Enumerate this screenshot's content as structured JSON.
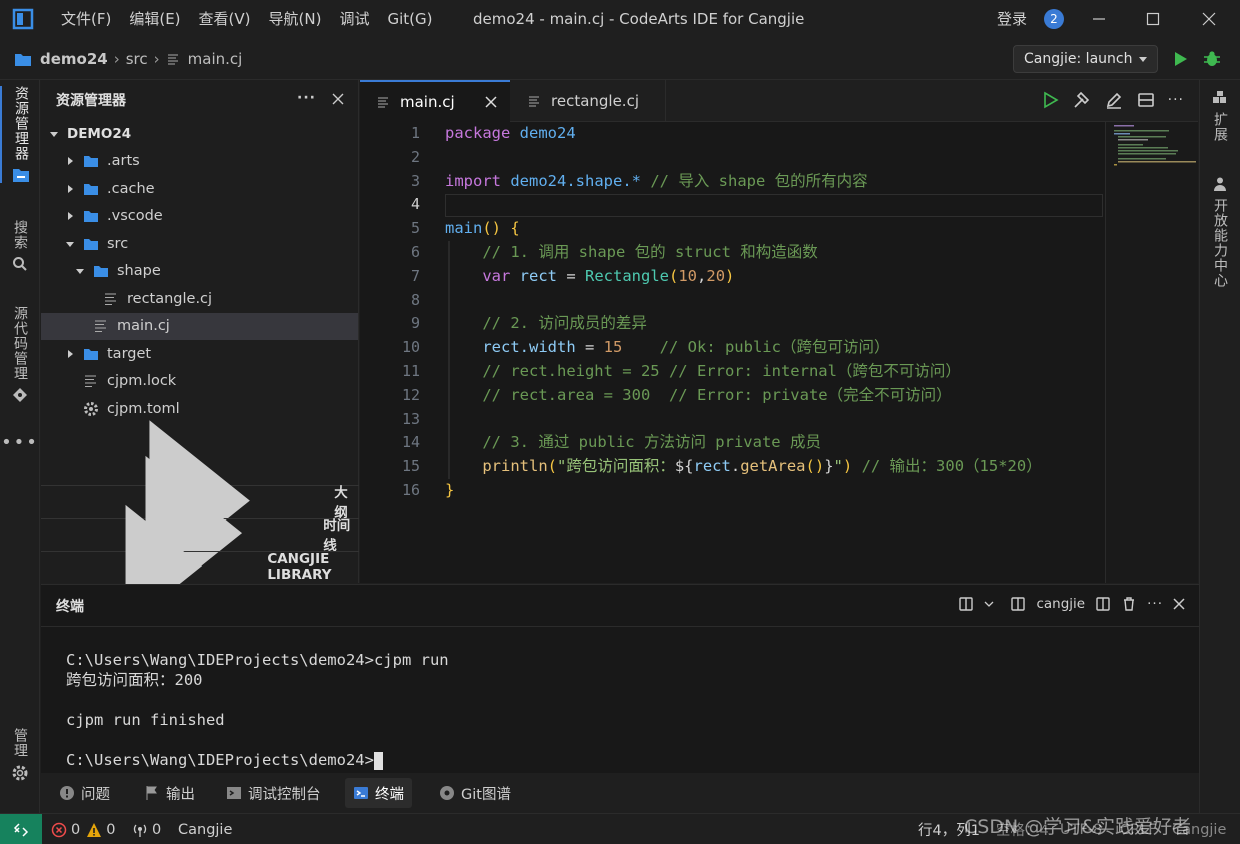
{
  "titlebar": {
    "menus": [
      "文件(F)",
      "编辑(E)",
      "查看(V)",
      "导航(N)",
      "调试",
      "Git(G)"
    ],
    "title": "demo24 - main.cj - CodeArts IDE for Cangjie",
    "login": "登录",
    "badge_count": "2"
  },
  "breadcrumb": {
    "project": "demo24",
    "folder": "src",
    "file": "main.cj"
  },
  "launch": {
    "label": "Cangjie: launch"
  },
  "activity": {
    "explorer": "资源管理器",
    "search": "搜索",
    "scm": "源代码管理",
    "manage": "管理"
  },
  "rightbar": {
    "extensions": "扩展",
    "open_center": "开放能力中心"
  },
  "sidebar": {
    "title": "资源管理器",
    "root": "DEMO24",
    "tree": [
      {
        "label": ".arts",
        "depth": 1,
        "kind": "folder",
        "open": false
      },
      {
        "label": ".cache",
        "depth": 1,
        "kind": "folder",
        "open": false
      },
      {
        "label": ".vscode",
        "depth": 1,
        "kind": "folder",
        "open": false
      },
      {
        "label": "src",
        "depth": 1,
        "kind": "folder",
        "open": true
      },
      {
        "label": "shape",
        "depth": 2,
        "kind": "folder",
        "open": true
      },
      {
        "label": "rectangle.cj",
        "depth": 3,
        "kind": "file"
      },
      {
        "label": "main.cj",
        "depth": 2,
        "kind": "file",
        "selected": true
      },
      {
        "label": "target",
        "depth": 1,
        "kind": "folder",
        "open": false
      },
      {
        "label": "cjpm.lock",
        "depth": 1,
        "kind": "file"
      },
      {
        "label": "cjpm.toml",
        "depth": 1,
        "kind": "gear"
      }
    ],
    "sections": [
      "大纲",
      "时间线",
      "CANGJIE LIBRARY"
    ]
  },
  "tabs": [
    {
      "label": "main.cj",
      "active": true
    },
    {
      "label": "rectangle.cj",
      "active": false
    }
  ],
  "editor": {
    "current_line": 4,
    "lines": [
      "package demo24",
      "",
      "import demo24.shape.* // 导入 shape 包的所有内容",
      "",
      "main() {",
      "    // 1. 调用 shape 包的 struct 和构造函数",
      "    var rect = Rectangle(10,20)",
      "",
      "    // 2. 访问成员的差异",
      "    rect.width = 15    // Ok: public（跨包可访问）",
      "    // rect.height = 25 // Error: internal（跨包不可访问）",
      "    // rect.area = 300  // Error: private（完全不可访问）",
      "",
      "    // 3. 通过 public 方法访问 private 成员",
      "    println(\"跨包访问面积：${rect.getArea()}\") // 输出：300（15*20）",
      "}"
    ]
  },
  "terminal": {
    "title": "终端",
    "shell": "cangjie",
    "lines": [
      "C:\\Users\\Wang\\IDEProjects\\demo24>cjpm run",
      "跨包访问面积：200",
      "",
      "cjpm run finished",
      "",
      "C:\\Users\\Wang\\IDEProjects\\demo24>"
    ]
  },
  "panel_tabs": [
    {
      "label": "问题",
      "icon": "info-icon"
    },
    {
      "label": "输出",
      "icon": "flag-icon"
    },
    {
      "label": "调试控制台",
      "icon": "debug-console-icon"
    },
    {
      "label": "终端",
      "icon": "terminal-icon",
      "active": true
    },
    {
      "label": "Git图谱",
      "icon": "git-graph-icon"
    }
  ],
  "statusbar": {
    "errors": "0",
    "warnings": "0",
    "ports": "0",
    "language": "Cangjie",
    "position": "行4，列1",
    "spaces": "空格：4",
    "encoding": "UTF-8",
    "eol": "CRLF",
    "lang_mode": "Cangjie"
  },
  "watermark": "CSDN @学习&实践爱好者",
  "colors": {
    "accent": "#3a7bd5",
    "remote": "#16825d",
    "folder_blue": "#3a8ee6",
    "run_green": "#3fb950"
  }
}
